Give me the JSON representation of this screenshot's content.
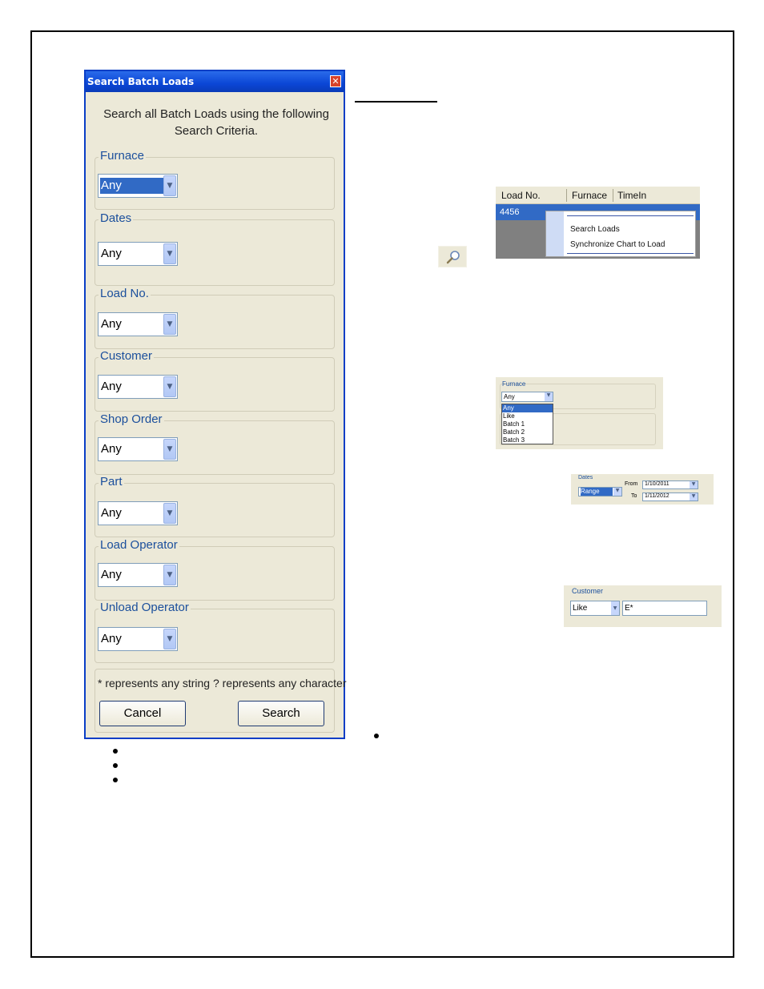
{
  "dialog": {
    "title": "Search Batch Loads",
    "close_glyph": "✕",
    "intro": "Search all Batch Loads using the following Search Criteria.",
    "groups": [
      {
        "label": "Furnace",
        "value": "Any"
      },
      {
        "label": "Dates",
        "value": "Any"
      },
      {
        "label": "Load No.",
        "value": "Any"
      },
      {
        "label": "Customer",
        "value": "Any"
      },
      {
        "label": "Shop Order",
        "value": "Any"
      },
      {
        "label": "Part",
        "value": "Any"
      },
      {
        "label": "Load Operator",
        "value": "Any"
      },
      {
        "label": "Unload Operator",
        "value": "Any"
      }
    ],
    "wildcard_note": "* represents any string   ? represents any character",
    "cancel_label": "Cancel",
    "search_label": "Search"
  },
  "load_list_shot": {
    "headers": [
      "Load No.",
      "Furnace",
      "TimeIn"
    ],
    "selected_row": "4456",
    "menu_items": [
      "Search Loads",
      "Synchronize Chart to Load"
    ]
  },
  "furnace_shot": {
    "group_label": "Furnace",
    "value": "Any",
    "options": [
      "Any",
      "Like",
      "Batch 1",
      "Batch 2",
      "Batch 3"
    ]
  },
  "dates_shot": {
    "group_label": "Dates",
    "mode": "Range",
    "from_label": "From",
    "from_value": "1/10/2011",
    "to_label": "To",
    "to_value": "1/11/2012"
  },
  "customer_shot": {
    "group_label": "Customer",
    "mode": "Like",
    "pattern": "E*"
  },
  "colors": {
    "title_bar": "#0b46d6",
    "selection": "#316ac5",
    "dialog_bg": "#ece9d8",
    "label_blue": "#1b4f9c"
  }
}
